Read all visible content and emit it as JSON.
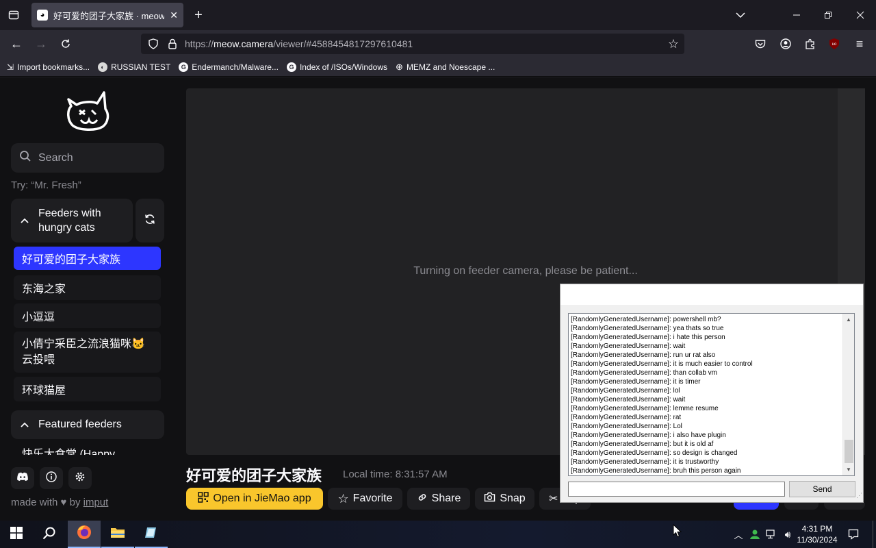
{
  "browser": {
    "tab_title": "好可爱的团子大家族 · meow.ca",
    "url_prefix": "https://",
    "url_domain": "meow.camera",
    "url_path": "/viewer/#4588454817297610481",
    "bookmarks": [
      {
        "label": "Import bookmarks..."
      },
      {
        "label": "RUSSIAN TEST"
      },
      {
        "label": "Endermanch/Malware..."
      },
      {
        "label": "Index of /ISOs/Windows"
      },
      {
        "label": "MEMZ and Noescape ..."
      }
    ]
  },
  "sidebar": {
    "search_placeholder": "Search",
    "try_hint": "Try: “Mr. Fresh”",
    "hungry_section_title": "Feeders with hungry cats",
    "feeders": [
      {
        "label": "好可爱的团子大家族",
        "active": true
      },
      {
        "label": "东海之家",
        "active": false
      },
      {
        "label": "小逗逗",
        "active": false
      },
      {
        "label": "小倩宁采臣之流浪猫咪🐱云投喂",
        "active": false
      },
      {
        "label": "环球猫屋",
        "active": false
      }
    ],
    "featured_section_title": "Featured feeders",
    "featured_partial": "快乐大食堂 (Happy",
    "footer_made_with": "made with",
    "footer_by": "by",
    "footer_author": "imput"
  },
  "viewer": {
    "status_message": "Turning on feeder camera, please be patient...",
    "feeder_title": "好可爱的团子大家族",
    "local_time": "Local time: 8:31:57 AM",
    "buttons": {
      "open_app": "Open in JieMao app",
      "favorite": "Favorite",
      "share": "Share",
      "snap": "Snap",
      "clip": "Clip"
    }
  },
  "chat": {
    "messages": [
      "[RandomlyGeneratedUsername]: powershell mb?",
      "[RandomlyGeneratedUsername]: yea thats so true",
      "[RandomlyGeneratedUsername]: i hate this person",
      "[RandomlyGeneratedUsername]: wait",
      "[RandomlyGeneratedUsername]: run ur rat also",
      "[RandomlyGeneratedUsername]: it is much easier to control",
      "[RandomlyGeneratedUsername]: than collab vm",
      "[RandomlyGeneratedUsername]: it is timer",
      "[RandomlyGeneratedUsername]: lol",
      "[RandomlyGeneratedUsername]: wait",
      "[RandomlyGeneratedUsername]: lemme resume",
      "[RandomlyGeneratedUsername]: rat",
      "[RandomlyGeneratedUsername]: Lol",
      "[RandomlyGeneratedUsername]: i also have plugin",
      "[RandomlyGeneratedUsername]: but it is old af",
      "[RandomlyGeneratedUsername]: so design is changed",
      "[RandomlyGeneratedUsername]: it is trustworthy",
      "[RandomlyGeneratedUsername]: bruh this person again"
    ],
    "input_value": "",
    "send_label": "Send"
  },
  "taskbar": {
    "time": "4:31 PM",
    "date": "11/30/2024"
  },
  "colors": {
    "accent_blue": "#2d36ff",
    "yellow_button": "#f9c62c"
  }
}
